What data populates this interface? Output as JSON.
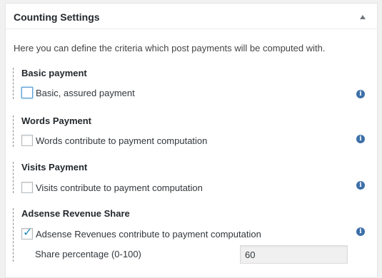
{
  "panel": {
    "title": "Counting Settings",
    "intro": "Here you can define the criteria which post payments will be computed with."
  },
  "sections": [
    {
      "title": "Basic payment",
      "option_label": "Basic, assured payment",
      "checked": false,
      "info_icon": "info-icon"
    },
    {
      "title": "Words Payment",
      "option_label": "Words contribute to payment computation",
      "checked": false,
      "info_icon": "info-icon"
    },
    {
      "title": "Visits Payment",
      "option_label": "Visits contribute to payment computation",
      "checked": false,
      "info_icon": "info-icon"
    },
    {
      "title": "Adsense Revenue Share",
      "option_label": "Adsense Revenues contribute to payment computation",
      "checked": true,
      "info_icon": "info-icon",
      "share_label": "Share percentage (0-100)",
      "share_value": "60"
    }
  ],
  "colors": {
    "accent": "#1e8cbe",
    "info": "#3c6fa8",
    "background": "#f1f1f1"
  }
}
